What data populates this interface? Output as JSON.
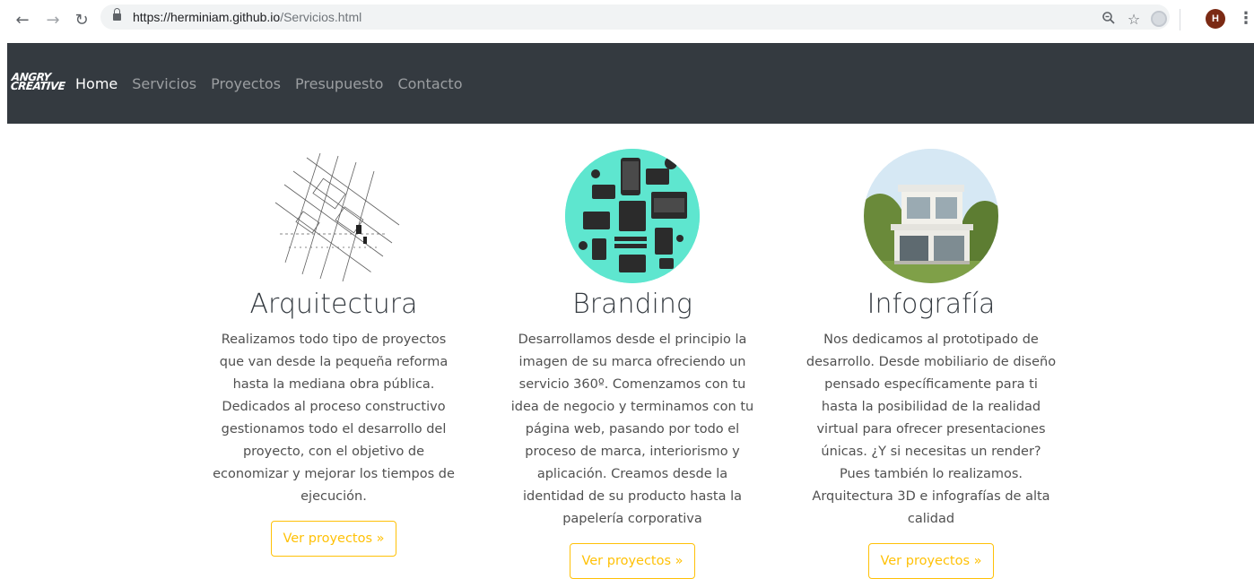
{
  "browser": {
    "url_host": "https://herminiam.github.io",
    "url_path": "/Servicios.html",
    "avatar_letter": "H",
    "icons": [
      "back-icon",
      "forward-icon",
      "reload-icon",
      "lock-icon",
      "zoom-icon",
      "star-icon",
      "extension-icon",
      "menu-icon"
    ]
  },
  "navbar": {
    "brand_line1": "ANGRY",
    "brand_line2": "CREATIVE",
    "links": [
      "Home",
      "Servicios",
      "Proyectos",
      "Presupuesto",
      "Contacto"
    ],
    "active": "Home"
  },
  "services": [
    {
      "title": "Arquitectura",
      "text": "Realizamos todo tipo de proyectos que van desde la pequeña reforma hasta la mediana obra pública. Dedicados al proceso constructivo gestionamos todo el desarrollo del proyecto, con el objetivo de economizar y mejorar los tiempos de ejecución.",
      "button": "Ver proyectos »"
    },
    {
      "title": "Branding",
      "text": "Desarrollamos desde el principio la imagen de su marca ofreciendo un servicio 360º. Comenzamos con tu idea de negocio y terminamos con tu página web, pasando por todo el proceso de marca, interiorismo y aplicación. Creamos desde la identidad de su producto hasta la papelería corporativa",
      "button": "Ver proyectos »"
    },
    {
      "title": "Infografía",
      "text": "Nos dedicamos al prototipado de desarrollo. Desde mobiliario de diseño pensado específicamente para ti hasta la posibilidad de la realidad virtual para ofrecer presentaciones únicas. ¿Y si necesitas un render? Pues también lo realizamos. Arquitectura 3D e infografías de alta calidad",
      "button": "Ver proyectos »"
    }
  ],
  "colors": {
    "navbar_bg": "#343a40",
    "button_accent": "#ffc107",
    "branding_bg": "#5ee6cf"
  }
}
